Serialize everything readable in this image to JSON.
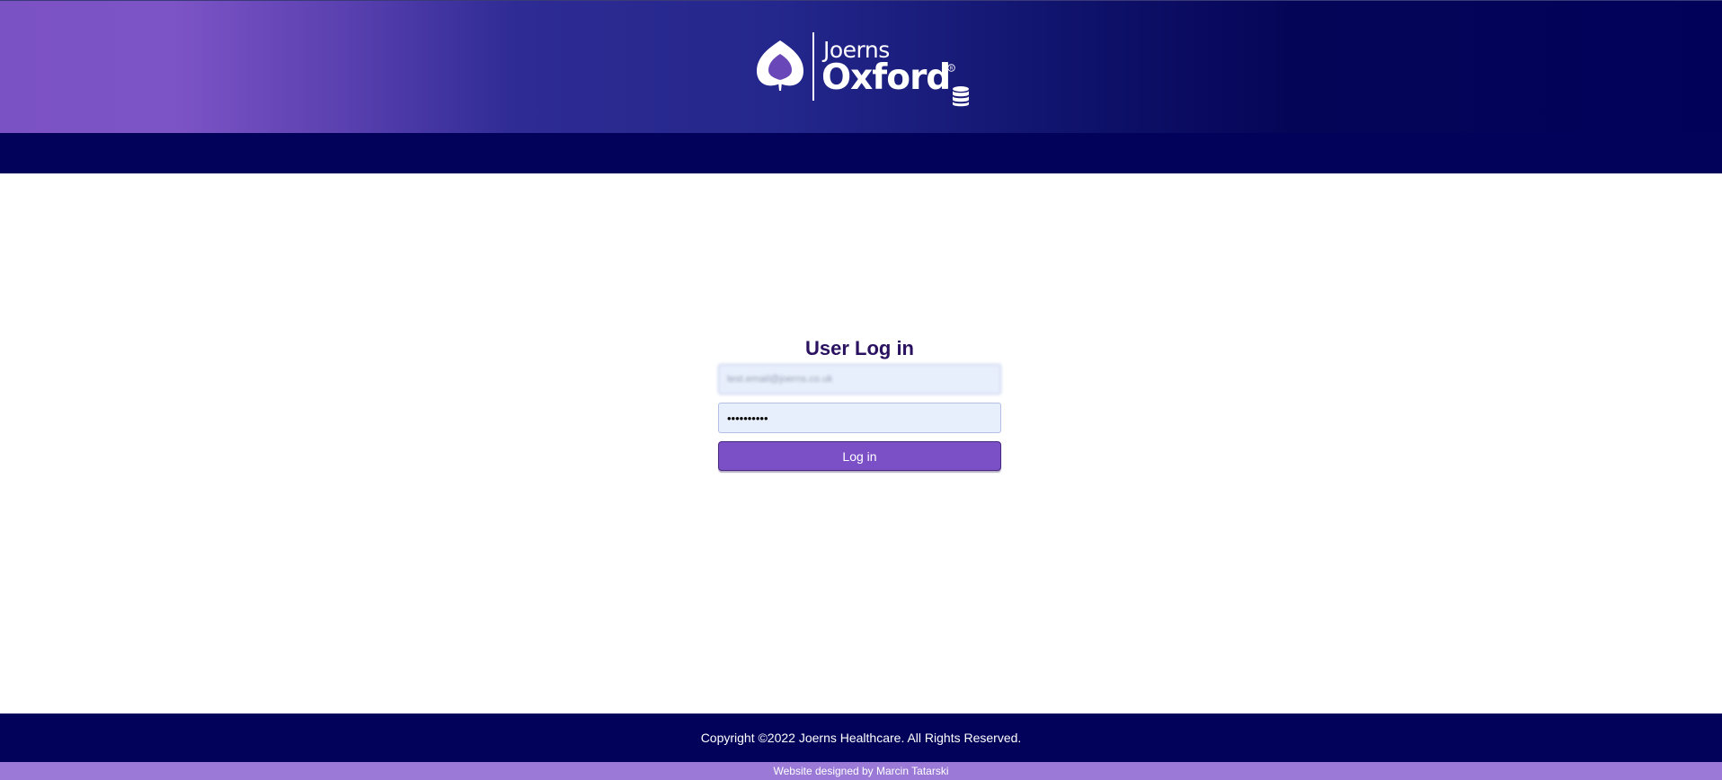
{
  "header": {
    "logo": {
      "brand_top": "Joerns",
      "brand_main": "Oxford",
      "registered_mark": "®"
    }
  },
  "login": {
    "title": "User Log in",
    "email_value": "test.email@joerns.co.uk",
    "password_value": "••••••••••",
    "submit_label": "Log in"
  },
  "footer": {
    "copyright": "Copyright ©2022 Joerns Healthcare. All Rights Reserved.",
    "designer": "Website designed by Marcin Tatarski"
  },
  "colors": {
    "header_gradient_start": "#7b52c4",
    "header_gradient_end": "#01015a",
    "navbar": "#02025b",
    "title": "#2a1260",
    "button": "#7b4fc6",
    "footer": "#02025b",
    "subfooter": "#9a7ad6"
  },
  "icons": {
    "logo_mark": "droplet-logo-icon",
    "database": "database-icon"
  }
}
